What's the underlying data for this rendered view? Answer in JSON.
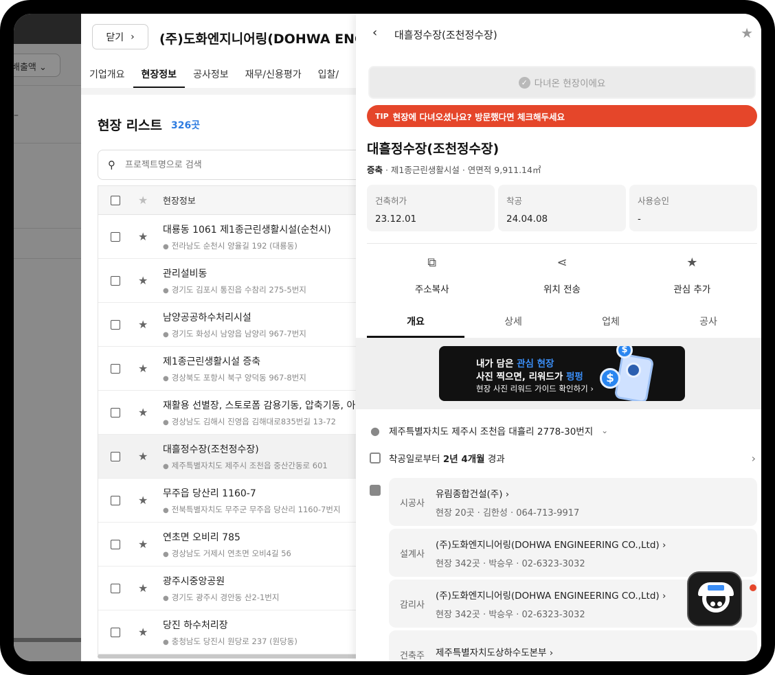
{
  "background_app": {
    "sales_button_label": "매출액 ∨",
    "sales_button_short": "배출액"
  },
  "company_panel": {
    "close_label": "닫기",
    "title": "(주)도화엔지니어링(DOHWA ENGIN",
    "tabs": [
      "기업개요",
      "현장정보",
      "공사정보",
      "재무/신용평가",
      "입찰/"
    ],
    "active_tab": "현장정보",
    "list_title": "현장 리스트",
    "list_count": "326곳",
    "search_placeholder": "프로젝트명으로 검색",
    "table_header": "현장정보",
    "rows": [
      {
        "name": "대룡동 1061 제1종근린생활시설(순천시)",
        "addr": "전라남도 순천시 양율길 192 (대룡동)"
      },
      {
        "name": "관리설비동",
        "addr": "경기도 김포시 통진읍 수참리 275-5번지"
      },
      {
        "name": "남양공공하수처리시설",
        "addr": "경기도 화성시 남양읍 남양리 967-7번지"
      },
      {
        "name": "제1종근린생활시설 증축",
        "addr": "경상북도 포항시 북구 양덕동 967-8번지"
      },
      {
        "name": "재활용 선별장, 스토로폼 감용기동, 압축기동, 아…",
        "addr": "경상남도 김해시 진영읍 김해대로835번길 13-72"
      },
      {
        "name": "대흘정수장(조천정수장)",
        "addr": "제주특별자치도 제주시 조천읍 중산간동로 601"
      },
      {
        "name": "무주읍 당산리 1160-7",
        "addr": "전북특별자치도 무주군 무주읍 당산리 1160-7번지"
      },
      {
        "name": "연초면 오비리 785",
        "addr": "경상남도 거제시 연초면 오비4길 56"
      },
      {
        "name": "광주시중앙공원",
        "addr": "경기도 광주시 경안동 산2-1번지"
      },
      {
        "name": "당진 하수처리장",
        "addr": "충청남도 당진시 원당로 237 (원당동)"
      }
    ],
    "selected_row": 5
  },
  "detail": {
    "header_title": "대흘정수장(조천정수장)",
    "visited_label": "다녀온 현장이에요",
    "tip_tag": "TIP",
    "tip_text": "현장에 다녀오셨나요? 방문했다면 체크해두세요",
    "site_title": "대흘정수장(조천정수장)",
    "site_type": "증축",
    "site_sub": " · 제1종근린생활시설 · 연면적 9,911.14㎡",
    "dates": [
      {
        "k": "건축허가",
        "v": "23.12.01"
      },
      {
        "k": "착공",
        "v": "24.04.08"
      },
      {
        "k": "사용승인",
        "v": "-"
      }
    ],
    "actions": [
      {
        "label": "주소복사",
        "icon": "copy-icon"
      },
      {
        "label": "위치 전송",
        "icon": "share-icon"
      },
      {
        "label": "관심 추가",
        "icon": "star-icon"
      }
    ],
    "tabs": [
      "개요",
      "상세",
      "업체",
      "공사"
    ],
    "active_tab": "개요",
    "banner": {
      "line1_a": "내가 담은 ",
      "line1_b": "관심 현장",
      "line2_a": "사진 찍으면, 리워드가 ",
      "line2_b": "펑펑",
      "line3": "현장 사진 리워드 가이드 확인하기 ›"
    },
    "address": "제주특별자치도 제주시 조천읍 대흘리 2778-30번지",
    "elapsed_a": "착공일로부터 ",
    "elapsed_b": "2년 4개월",
    "elapsed_c": " 경과",
    "firms": [
      {
        "role": "시공사",
        "name": "유림종합건설(주)",
        "meta": "현장 20곳 · 김한성 · 064-713-9917"
      },
      {
        "role": "설계사",
        "name": "(주)도화엔지니어링(DOHWA ENGINEERING CO.,Ltd)",
        "meta": "현장 342곳 · 박승우 · 02-6323-3032"
      },
      {
        "role": "감리사",
        "name": "(주)도화엔지니어링(DOHWA ENGINEERING CO.,Ltd)",
        "meta": "현장 342곳 · 박승우 · 02-6323-3032"
      },
      {
        "role": "건축주",
        "name": "제주특별자치도상하수도본부",
        "meta": ""
      }
    ]
  }
}
